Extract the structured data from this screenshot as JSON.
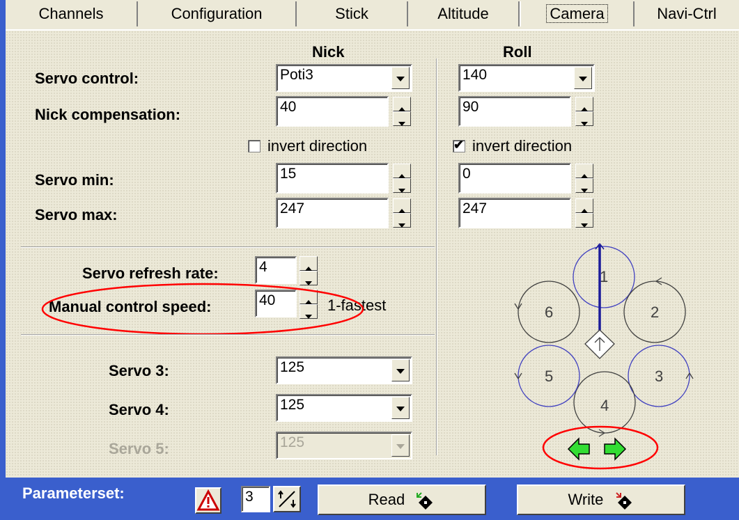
{
  "tabs": [
    "Channels",
    "Configuration",
    "Stick",
    "Altitude",
    "Camera",
    "Navi-Ctrl"
  ],
  "columns": {
    "nick": "Nick",
    "roll": "Roll"
  },
  "rows": {
    "servo_control": {
      "label": "Servo control:",
      "nick": "Poti3",
      "roll": "140"
    },
    "nick_compensation": {
      "label": "Nick compensation:",
      "nick": "40",
      "roll": "90"
    },
    "invert": {
      "nick_label": "invert direction",
      "nick_checked": false,
      "roll_label": "invert direction",
      "roll_checked": true
    },
    "servo_min": {
      "label": "Servo min:",
      "nick": "15",
      "roll": "0"
    },
    "servo_max": {
      "label": "Servo max:",
      "nick": "247",
      "roll": "247"
    }
  },
  "refresh": {
    "label": "Servo refresh rate:",
    "value": "4"
  },
  "manual": {
    "label": "Manual control speed:",
    "value": "40",
    "hint": "1-fastest"
  },
  "servos": {
    "s3": {
      "label": "Servo 3:",
      "value": "125"
    },
    "s4": {
      "label": "Servo 4:",
      "value": "125"
    },
    "s5": {
      "label": "Servo 5:",
      "value": "125"
    }
  },
  "diagram": {
    "motors": [
      "1",
      "2",
      "3",
      "4",
      "5",
      "6"
    ]
  },
  "footer": {
    "title": "Parameterset:",
    "set_value": "3",
    "read_label": "Read",
    "write_label": "Write"
  },
  "colors": {
    "accent": "#3a5fcd",
    "highlight": "#ff0000",
    "arrow_green": "#33dd33",
    "rotor_blue": "#4040c0"
  }
}
